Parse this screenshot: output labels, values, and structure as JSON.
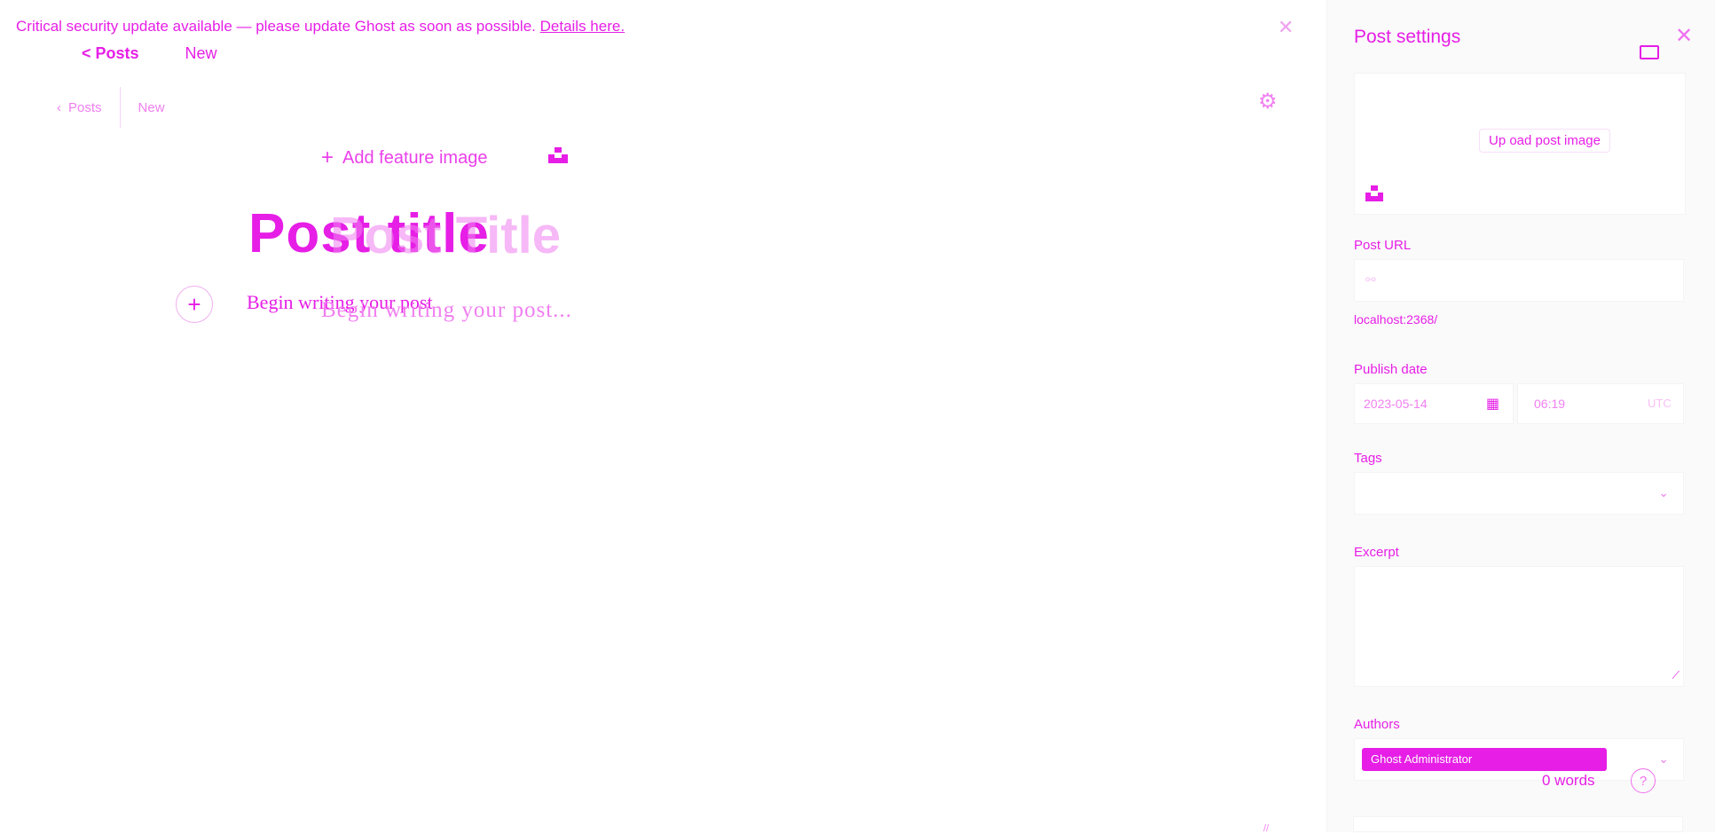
{
  "banner": {
    "message": "Critical security update available — please update Ghost as soon as possible.",
    "link": "Details here."
  },
  "ghost_nav": {
    "back": "< Posts",
    "status": "New"
  },
  "nav": {
    "posts": "Posts",
    "status": "New"
  },
  "editor": {
    "feature_image": "Add feature image",
    "title": "Post title",
    "title_ghost": "Post Title",
    "body_placeholder": "Begin writing your post",
    "body_placeholder_ghost": "Begin writing your post..."
  },
  "settings": {
    "title": "Post settings",
    "upload_label": "Up oad post image",
    "url_label": "Post URL",
    "url_hint": "localhost:2368/",
    "date_label": "Publish date",
    "date_value": "2023-05-14",
    "time_value": "06:19",
    "tz_value": "UTC",
    "tags_label": "Tags",
    "excerpt_label": "Excerpt",
    "authors_label": "Authors",
    "author_name": "Ghost Administrator"
  },
  "footer": {
    "word_count": "0 words",
    "help": "?"
  },
  "colors": {
    "accent": "#e61ee6",
    "panel_bg": "#fafafa"
  }
}
